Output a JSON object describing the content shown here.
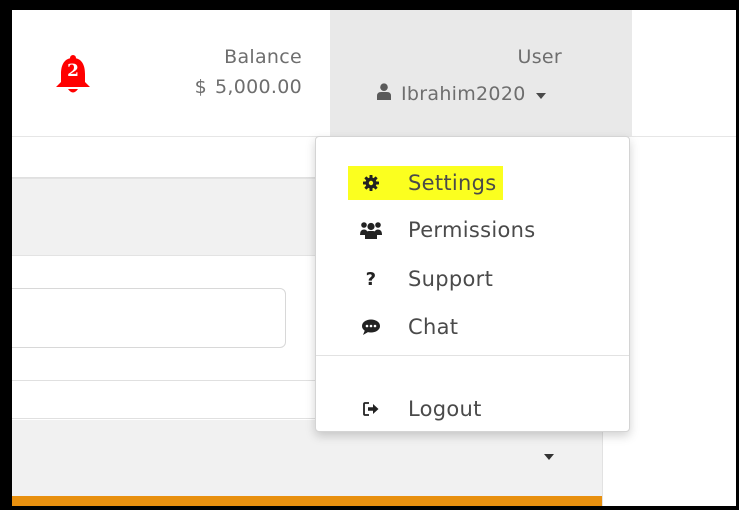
{
  "header": {
    "notifications": {
      "icon": "bell-icon",
      "count": "2",
      "color": "#ff0000"
    },
    "balance": {
      "label": "Balance",
      "currency_symbol": "$",
      "amount": "5,000.00"
    },
    "user": {
      "label": "User",
      "icon": "user-icon",
      "name": "Ibrahim2020",
      "caret_icon": "caret-down-icon"
    }
  },
  "dropdown": {
    "items": [
      {
        "icon": "gear-icon",
        "label": "Settings",
        "highlighted": true,
        "highlight_color": "#fbff1f"
      },
      {
        "icon": "users-icon",
        "label": "Permissions"
      },
      {
        "icon": "question-icon",
        "label": "Support"
      },
      {
        "icon": "chat-icon",
        "label": "Chat"
      },
      {
        "icon": "logout-icon",
        "label": "Logout"
      }
    ]
  },
  "page": {
    "accent_color": "#e8900f"
  }
}
